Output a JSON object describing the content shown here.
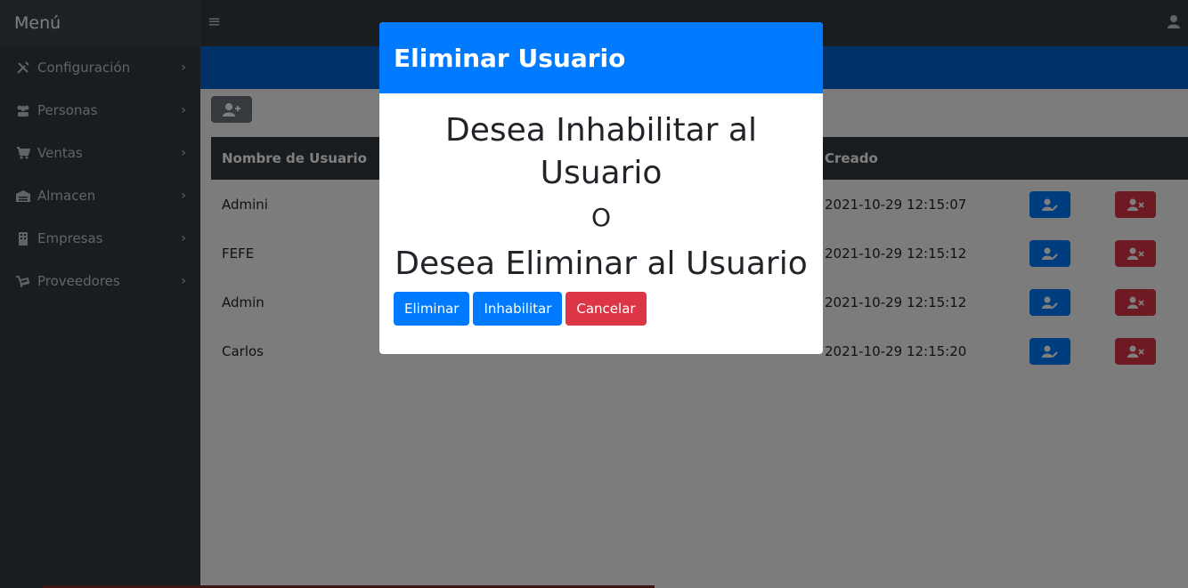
{
  "sidebar": {
    "title": "Menú",
    "items": [
      {
        "label": "Configuración",
        "icon": "tools-icon"
      },
      {
        "label": "Personas",
        "icon": "users-icon"
      },
      {
        "label": "Ventas",
        "icon": "cart-icon"
      },
      {
        "label": "Almacen",
        "icon": "warehouse-icon"
      },
      {
        "label": "Empresas",
        "icon": "building-icon"
      },
      {
        "label": "Proveedores",
        "icon": "truck-icon"
      }
    ],
    "chevron": "›"
  },
  "topbar": {
    "menu_glyph": "≡"
  },
  "table": {
    "headers": [
      "Nombre de Usuario",
      "Creado"
    ],
    "rows": [
      {
        "name": "Admini",
        "created": "2021-10-29 12:15:07"
      },
      {
        "name": "FEFE",
        "created": "2021-10-29 12:15:12"
      },
      {
        "name": "Admin",
        "created": "2021-10-29 12:15:12"
      },
      {
        "name": "Carlos",
        "created": "2021-10-29 12:15:20"
      }
    ]
  },
  "modal": {
    "title": "Eliminar Usuario",
    "line1": "Desea Inhabilitar al Usuario",
    "or": "O",
    "line2": "Desea Eliminar al Usuario",
    "buttons": {
      "delete": "Eliminar",
      "disable": "Inhabilitar",
      "cancel": "Cancelar"
    }
  },
  "colors": {
    "primary": "#007bff",
    "danger": "#dc3545",
    "dark": "#343a40",
    "secondary": "#6c757d"
  }
}
